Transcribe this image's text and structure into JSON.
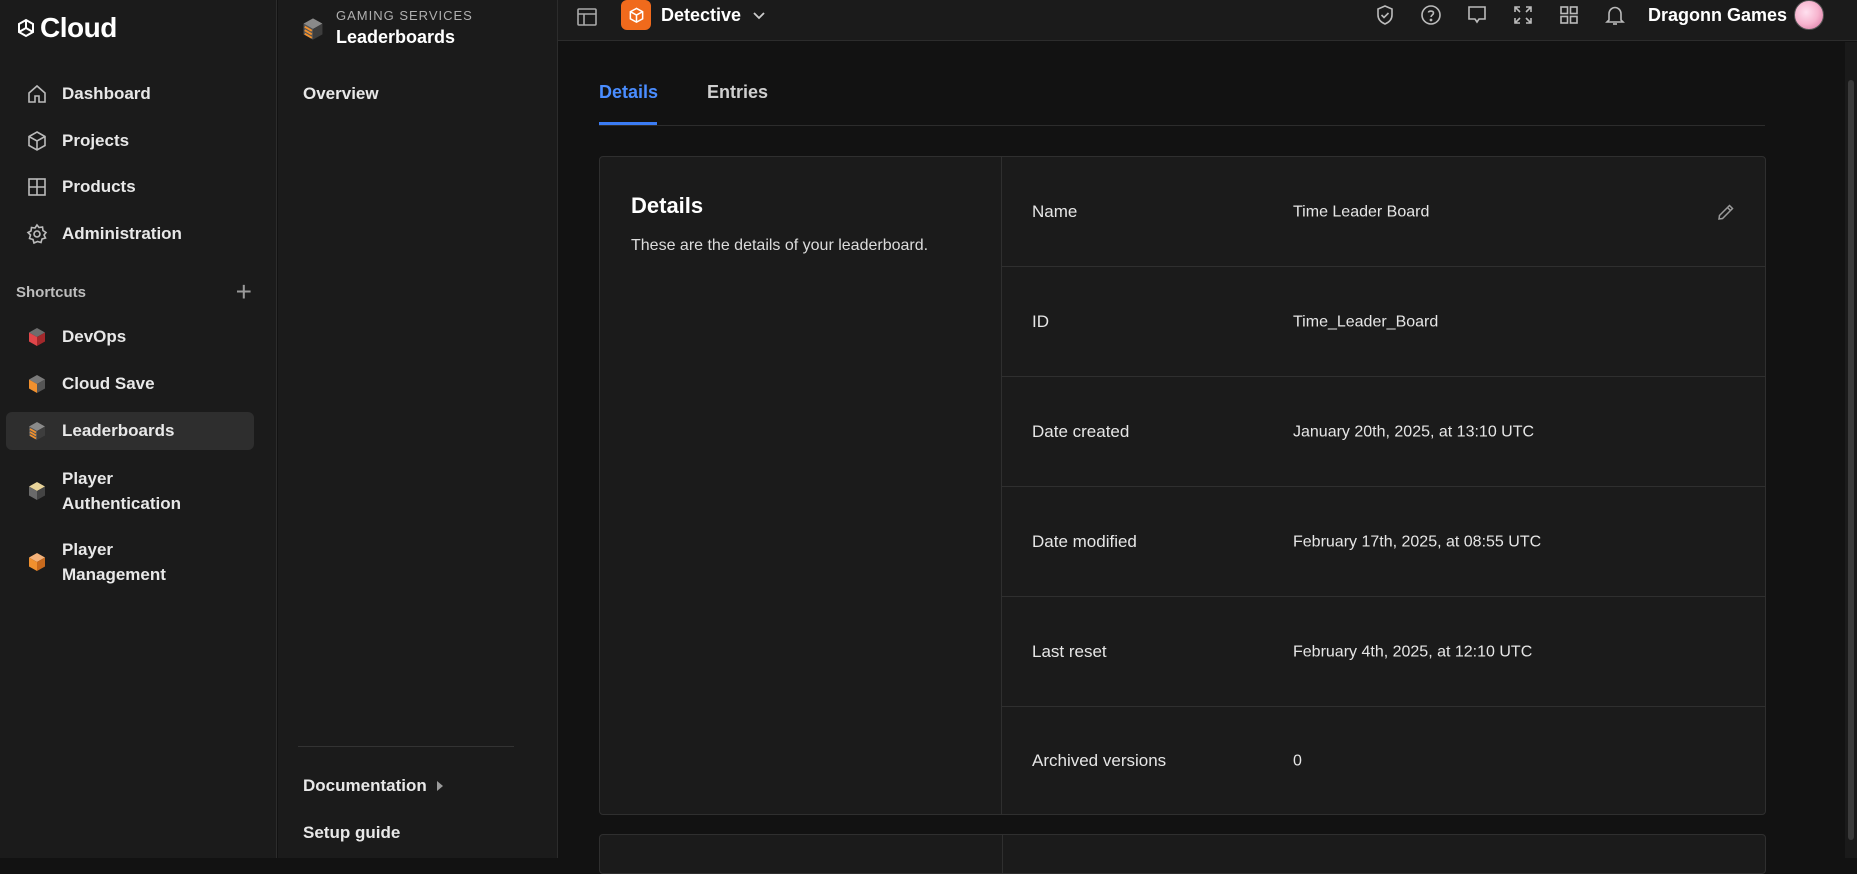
{
  "app": {
    "brand": "Cloud"
  },
  "sidebar": {
    "items": [
      {
        "label": "Dashboard",
        "icon": "home-icon"
      },
      {
        "label": "Projects",
        "icon": "box-icon"
      },
      {
        "label": "Products",
        "icon": "grid-icon"
      },
      {
        "label": "Administration",
        "icon": "gear-icon"
      }
    ],
    "shortcuts_label": "Shortcuts",
    "shortcuts": [
      {
        "label": "DevOps",
        "icon": "devops-cube-icon",
        "color": "#e0464a"
      },
      {
        "label": "Cloud Save",
        "icon": "cloud-save-cube-icon",
        "color": "#f0902e"
      },
      {
        "label": "Leaderboards",
        "icon": "leaderboards-cube-icon",
        "color": "#f0902e",
        "active": true
      },
      {
        "label": "Player Authentication",
        "icon": "auth-cube-icon",
        "color": "#e8d49a"
      },
      {
        "label": "Player Management",
        "icon": "management-cube-icon",
        "color": "#f0902e"
      }
    ]
  },
  "subnav": {
    "kicker": "GAMING SERVICES",
    "title": "Leaderboards",
    "overview": "Overview",
    "documentation": "Documentation",
    "setup_guide": "Setup guide"
  },
  "topbar": {
    "project": "Detective",
    "organization": "Dragonn Games",
    "accent": "#f06a1c"
  },
  "tabs": [
    {
      "label": "Details",
      "active": true
    },
    {
      "label": "Entries",
      "active": false
    }
  ],
  "details": {
    "title": "Details",
    "description": "These are the details of your leaderboard.",
    "rows": [
      {
        "label": "Name",
        "value": "Time Leader Board"
      },
      {
        "label": "ID",
        "value": "Time_Leader_Board"
      },
      {
        "label": "Date created",
        "value": "January 20th, 2025, at 13:10 UTC"
      },
      {
        "label": "Date modified",
        "value": "February 17th, 2025, at 08:55 UTC"
      },
      {
        "label": "Last reset",
        "value": "February 4th, 2025, at 12:10 UTC"
      },
      {
        "label": "Archived versions",
        "value": "0"
      }
    ]
  }
}
